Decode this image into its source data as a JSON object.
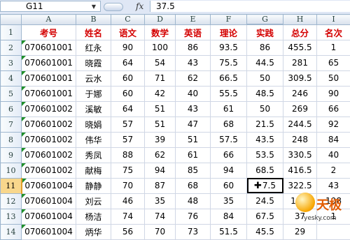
{
  "formula_bar": {
    "name_box": "G11",
    "fx_label": "fx",
    "value": "37.5"
  },
  "columns": [
    "A",
    "B",
    "C",
    "D",
    "E",
    "F",
    "G",
    "H",
    "I"
  ],
  "header_row": {
    "row_num": "1",
    "cells": [
      "考号",
      "姓名",
      "语文",
      "数学",
      "英语",
      "理论",
      "实践",
      "总分",
      "名次"
    ]
  },
  "rows": [
    {
      "row_num": "2",
      "cells": [
        "070601001",
        "红永",
        "90",
        "100",
        "86",
        "93.5",
        "86",
        "455.5",
        "1"
      ]
    },
    {
      "row_num": "3",
      "cells": [
        "070601001",
        "晓霞",
        "64",
        "54",
        "43",
        "75.5",
        "44.5",
        "281",
        "65"
      ]
    },
    {
      "row_num": "4",
      "cells": [
        "070601001",
        "云水",
        "60",
        "71",
        "62",
        "66.5",
        "50",
        "309.5",
        "50"
      ]
    },
    {
      "row_num": "5",
      "cells": [
        "070601001",
        "于娜",
        "60",
        "42",
        "40",
        "55.5",
        "48.5",
        "246",
        "90"
      ]
    },
    {
      "row_num": "6",
      "cells": [
        "070601002",
        "溪敏",
        "64",
        "51",
        "43",
        "61",
        "50",
        "269",
        "66"
      ]
    },
    {
      "row_num": "7",
      "cells": [
        "070601002",
        "晓娟",
        "57",
        "51",
        "47",
        "68",
        "21.5",
        "244.5",
        "92"
      ]
    },
    {
      "row_num": "8",
      "cells": [
        "070601002",
        "伟华",
        "57",
        "39",
        "51",
        "57.5",
        "43.5",
        "248",
        "84"
      ]
    },
    {
      "row_num": "9",
      "cells": [
        "070601002",
        "秀凤",
        "88",
        "62",
        "61",
        "66",
        "53.5",
        "330.5",
        "40"
      ]
    },
    {
      "row_num": "10",
      "cells": [
        "070601002",
        "献梅",
        "75",
        "94",
        "85",
        "94",
        "68.5",
        "416.5",
        "2"
      ]
    },
    {
      "row_num": "11",
      "cells": [
        "070601004",
        "静静",
        "70",
        "87",
        "68",
        "60",
        "37.5",
        "322.5",
        "43"
      ]
    },
    {
      "row_num": "12",
      "cells": [
        "070601004",
        "刘云",
        "46",
        "35",
        "48",
        "35",
        "24.5",
        "189.",
        "108"
      ]
    },
    {
      "row_num": "13",
      "cells": [
        "070601004",
        "杨洁",
        "74",
        "74",
        "76",
        "84",
        "67.5",
        "37",
        "1"
      ]
    },
    {
      "row_num": "14",
      "cells": [
        "070601004",
        "炳华",
        "56",
        "70",
        "73",
        "51.5",
        "45.5",
        "29",
        ""
      ]
    }
  ],
  "watermark": {
    "logo": "天极",
    "site": "yesky.com"
  }
}
